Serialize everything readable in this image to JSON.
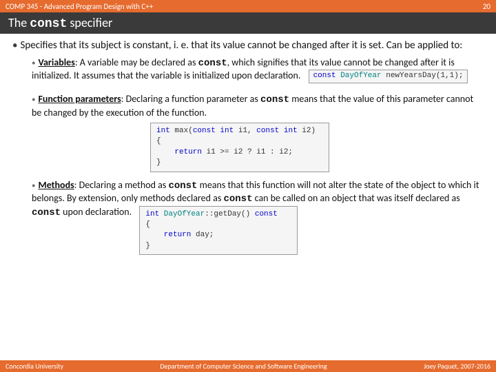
{
  "header": {
    "course": "COMP 345 - Advanced Program Design with C++",
    "slide_no": "20",
    "title_pre": "The ",
    "title_kw": "const",
    "title_post": " specifier"
  },
  "b1": {
    "text": "Specifies that its subject is constant, i. e. that its value cannot be changed after it is set. Can be applied to:"
  },
  "b2a": {
    "label": "Variables",
    "pre": ": A variable may be declared as ",
    "kw": "const",
    "post": ", which signifies that its value cannot be changed after it is initialized. It assumes that the variable is initialized upon declaration.",
    "code": "const DayOfYear newYearsDay(1,1);"
  },
  "b2b": {
    "label": "Function parameters",
    "pre": ": Declaring a function parameter as ",
    "kw": "const",
    "post": " means that the value of this parameter cannot be changed by the execution of the function.",
    "code": "int max(const int i1, const int i2)\n{\n    return i1 >= i2 ? i1 : i2;\n}"
  },
  "b2c": {
    "label": "Methods",
    "pre": ": Declaring a method as ",
    "kw": "const",
    "mid": " means that this function will not alter the state of the object to which it belongs. By extension, only methods declared as ",
    "kw2": "const",
    "mid2": " can be called on an object that was itself declared as ",
    "kw3": "const",
    "post": " upon declaration.",
    "code": "int DayOfYear::getDay() const\n{\n    return day;\n}"
  },
  "footer": {
    "left": "Concordia University",
    "center": "Department of Computer Science and Software Engineering",
    "right": "Joey Paquet, 2007-2016"
  }
}
